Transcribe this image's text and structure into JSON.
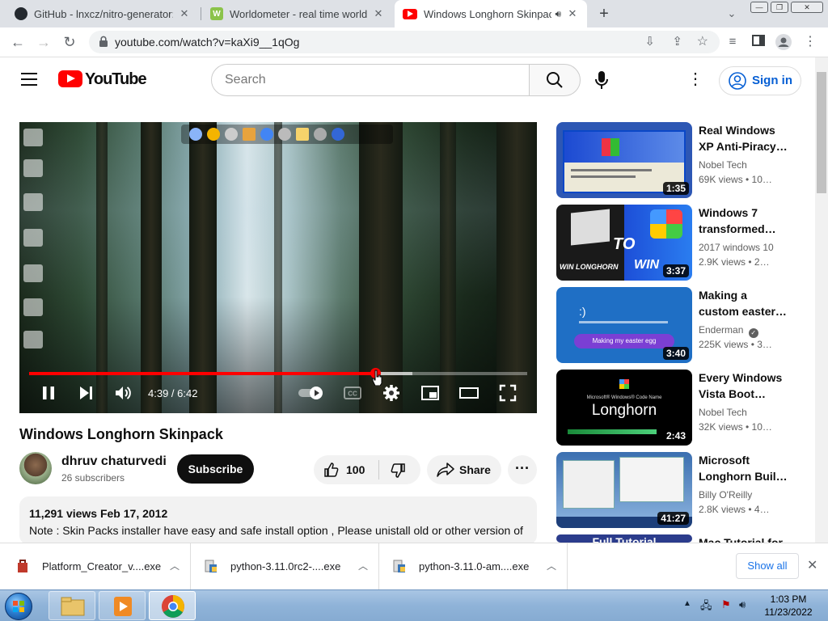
{
  "browser": {
    "tabs": [
      {
        "title": "GitHub - lnxcz/nitro-generator: ",
        "favicon": "github-icon",
        "active": false
      },
      {
        "title": "Worldometer - real time world st",
        "favicon": "worldometer-icon",
        "active": false
      },
      {
        "title": "Windows Longhorn Skinpack",
        "favicon": "youtube-icon",
        "active": true,
        "audio": true
      }
    ],
    "url": "youtube.com/watch?v=kaXi9__1qOg"
  },
  "youtube": {
    "logo_text": "YouTube",
    "search_placeholder": "Search",
    "sign_in_label": "Sign in"
  },
  "player": {
    "time_text": "4:39 / 6:42",
    "progress_fraction": 0.694,
    "buffered_fraction": 0.77,
    "accent_color": "#ff0000"
  },
  "video": {
    "title": "Windows Longhorn Skinpack",
    "channel_name": "dhruv chaturvedi",
    "subscribers": "26 subscribers",
    "subscribe_label": "Subscribe",
    "likes": "100",
    "share_label": "Share",
    "views_date": "11,291 views  Feb 17, 2012",
    "description_line1": "Note : Skin Packs installer have easy and safe install option , Please unistall old or other version of"
  },
  "recommendations": [
    {
      "title": "Real Windows XP Anti-Piracy…",
      "channel": "Nobel Tech",
      "meta": "69K views • 10…",
      "duration": "1:35",
      "verified": false
    },
    {
      "title": "Windows 7 transformed…",
      "channel": "2017 windows 10",
      "meta": "2.9K views • 2…",
      "duration": "3:37",
      "verified": false
    },
    {
      "title": "Making a custom easter…",
      "channel": "Enderman",
      "meta": "225K views • 3…",
      "duration": "3:40",
      "verified": true
    },
    {
      "title": "Every Windows Vista Boot…",
      "channel": "Nobel Tech",
      "meta": "32K views • 10…",
      "duration": "2:43",
      "verified": false
    },
    {
      "title": "Microsoft Longhorn Buil…",
      "channel": "Billy O'Reilly",
      "meta": "2.8K views • 4…",
      "duration": "41:27",
      "verified": false
    },
    {
      "title": "Mac Tutorial for",
      "channel": "",
      "meta": "",
      "duration": "",
      "verified": false
    }
  ],
  "thumb_text": {
    "t4_line1": "Microsoft® Windows® Code Name",
    "t4_line2": "Longhorn",
    "t2_text": "TO",
    "t2_left": "WIN LONGHORN",
    "t2_right": "WIN",
    "t3_text": "Making my easter egg",
    "t5_text": "Full Tutorial"
  },
  "downloads": {
    "items": [
      {
        "name": "Platform_Creator_v....exe"
      },
      {
        "name": "python-3.11.0rc2-....exe"
      },
      {
        "name": "python-3.11.0-am....exe"
      }
    ],
    "show_all_label": "Show all"
  },
  "taskbar": {
    "time": "1:03 PM",
    "date": "11/23/2022"
  }
}
